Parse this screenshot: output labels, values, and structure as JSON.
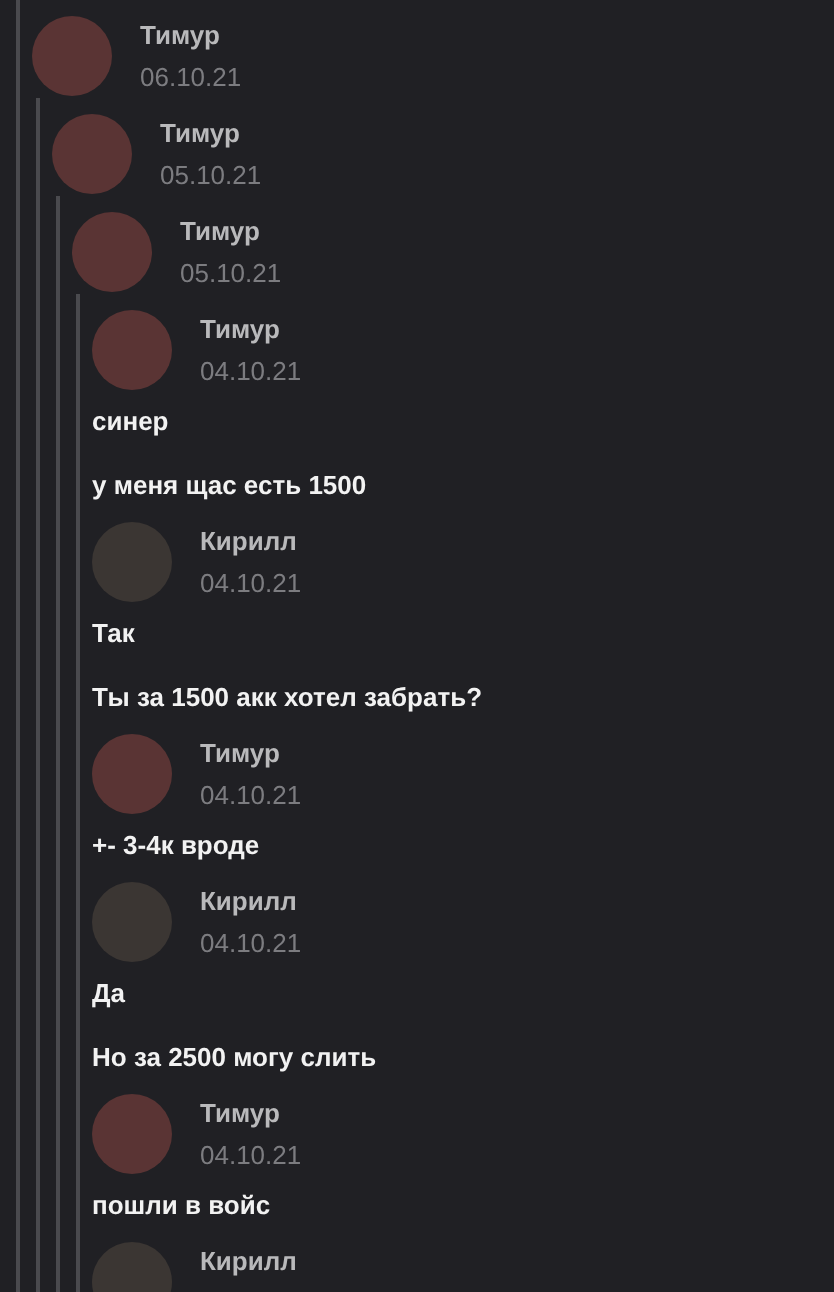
{
  "thread": {
    "author": "Тимур",
    "date": "06.10.21",
    "children": [
      {
        "author": "Тимур",
        "date": "05.10.21",
        "children": [
          {
            "author": "Тимур",
            "date": "05.10.21",
            "children": [
              {
                "author": "Тимур",
                "date": "04.10.21",
                "lines": [
                  "синер",
                  "у меня щас есть 1500"
                ]
              },
              {
                "author": "Кирилл",
                "date": "04.10.21",
                "lines": [
                  "Так",
                  "Ты за 1500 акк хотел забрать?"
                ]
              },
              {
                "author": "Тимур",
                "date": "04.10.21",
                "lines": [
                  "+- 3-4к вроде"
                ]
              },
              {
                "author": "Кирилл",
                "date": "04.10.21",
                "lines": [
                  "Да",
                  "Но за 2500 могу слить"
                ]
              },
              {
                "author": "Тимур",
                "date": "04.10.21",
                "lines": [
                  "пошли в войс"
                ]
              },
              {
                "author": "Кирилл"
              }
            ]
          }
        ]
      }
    ]
  }
}
